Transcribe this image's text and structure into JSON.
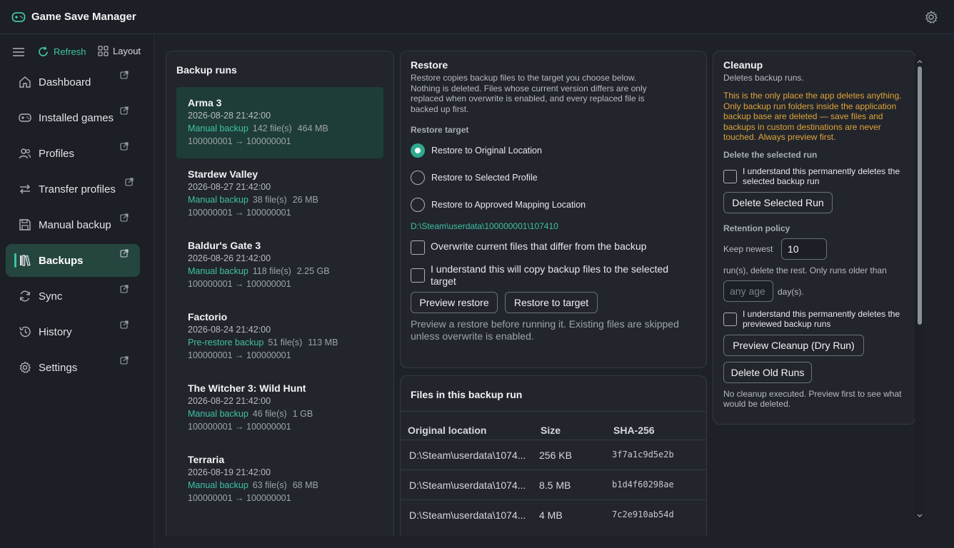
{
  "app": {
    "title": "Game Save Manager"
  },
  "toolbar": {
    "refresh_label": "Refresh",
    "layout_label": "Layout"
  },
  "sidebar": {
    "items": [
      {
        "label": "Dashboard",
        "icon": "home-icon"
      },
      {
        "label": "Installed games",
        "icon": "gamepad-icon"
      },
      {
        "label": "Profiles",
        "icon": "users-icon"
      },
      {
        "label": "Transfer profiles",
        "icon": "transfer-icon"
      },
      {
        "label": "Manual backup",
        "icon": "save-icon"
      },
      {
        "label": "Backups",
        "icon": "library-icon",
        "active": true
      },
      {
        "label": "Sync",
        "icon": "sync-icon"
      },
      {
        "label": "History",
        "icon": "history-icon"
      },
      {
        "label": "Settings",
        "icon": "gear-icon"
      }
    ]
  },
  "backup_runs": {
    "title": "Backup runs",
    "runs": [
      {
        "name": "Arma 3",
        "date": "2026-08-28 21:42:00",
        "type": "Manual backup",
        "files": "142 file(s)",
        "size": "464 MB",
        "ids": "100000001 → 100000001",
        "selected": true
      },
      {
        "name": "Stardew Valley",
        "date": "2026-08-27 21:42:00",
        "type": "Manual backup",
        "files": "38 file(s)",
        "size": "26 MB",
        "ids": "100000001 → 100000001"
      },
      {
        "name": "Baldur's Gate 3",
        "date": "2026-08-26 21:42:00",
        "type": "Manual backup",
        "files": "118 file(s)",
        "size": "2.25 GB",
        "ids": "100000001 → 100000001"
      },
      {
        "name": "Factorio",
        "date": "2026-08-24 21:42:00",
        "type": "Pre-restore backup",
        "files": "51 file(s)",
        "size": "113 MB",
        "ids": "100000001 → 100000001"
      },
      {
        "name": "The Witcher 3: Wild Hunt",
        "date": "2026-08-22 21:42:00",
        "type": "Manual backup",
        "files": "46 file(s)",
        "size": "1 GB",
        "ids": "100000001 → 100000001"
      },
      {
        "name": "Terraria",
        "date": "2026-08-19 21:42:00",
        "type": "Manual backup",
        "files": "63 file(s)",
        "size": "68 MB",
        "ids": "100000001 → 100000001"
      }
    ]
  },
  "restore": {
    "title": "Restore",
    "description": "Restore copies backup files to the target you choose below. Nothing is deleted. Files whose current version differs are only replaced when overwrite is enabled, and every replaced file is backed up first.",
    "target_label": "Restore target",
    "options": [
      {
        "label": "Restore to Original Location",
        "checked": true
      },
      {
        "label": "Restore to Selected Profile",
        "checked": false
      },
      {
        "label": "Restore to Approved Mapping Location",
        "checked": false
      }
    ],
    "path": "D:\\Steam\\userdata\\100000001\\107410",
    "overwrite_label": "Overwrite current files that differ from the backup",
    "confirm_label": "I understand this will copy backup files to the selected target",
    "preview_button": "Preview restore",
    "restore_button": "Restore to target",
    "hint": "Preview a restore before running it. Existing files are skipped unless overwrite is enabled."
  },
  "files": {
    "title": "Files in this backup run",
    "columns": [
      "Original location",
      "Size",
      "SHA-256"
    ],
    "rows": [
      [
        "D:\\Steam\\userdata\\1074...",
        "256 KB",
        "3f7a1c9d5e2b"
      ],
      [
        "D:\\Steam\\userdata\\1074...",
        "8.5 MB",
        "b1d4f60298ae"
      ],
      [
        "D:\\Steam\\userdata\\1074...",
        "4 MB",
        "7c2e910ab54d"
      ]
    ]
  },
  "cleanup": {
    "title": "Cleanup",
    "subtitle": "Deletes backup runs.",
    "warning": "This is the only place the app deletes anything. Only backup run folders inside the application backup base are deleted — save files and backups in custom destinations are never touched. Always preview first.",
    "delete_section": "Delete the selected run",
    "delete_confirm": "I understand this permanently deletes the selected backup run",
    "delete_button": "Delete Selected Run",
    "retention_section": "Retention policy",
    "keep_newest": "Keep newest",
    "keep_value": "10",
    "runs_text": "run(s), delete the rest.  Only runs older than",
    "age_placeholder": "any age",
    "days_text": "day(s).",
    "cleanup_confirm": "I understand this permanently deletes the previewed backup runs",
    "preview_button": "Preview Cleanup (Dry Run)",
    "delete_old_button": "Delete Old Runs",
    "status": "No cleanup executed. Preview first to see what would be deleted."
  },
  "colors": {
    "accent": "#3fc2a5",
    "warning": "#e0a43a",
    "background": "#1e2128",
    "active_nav": "#24463f"
  }
}
